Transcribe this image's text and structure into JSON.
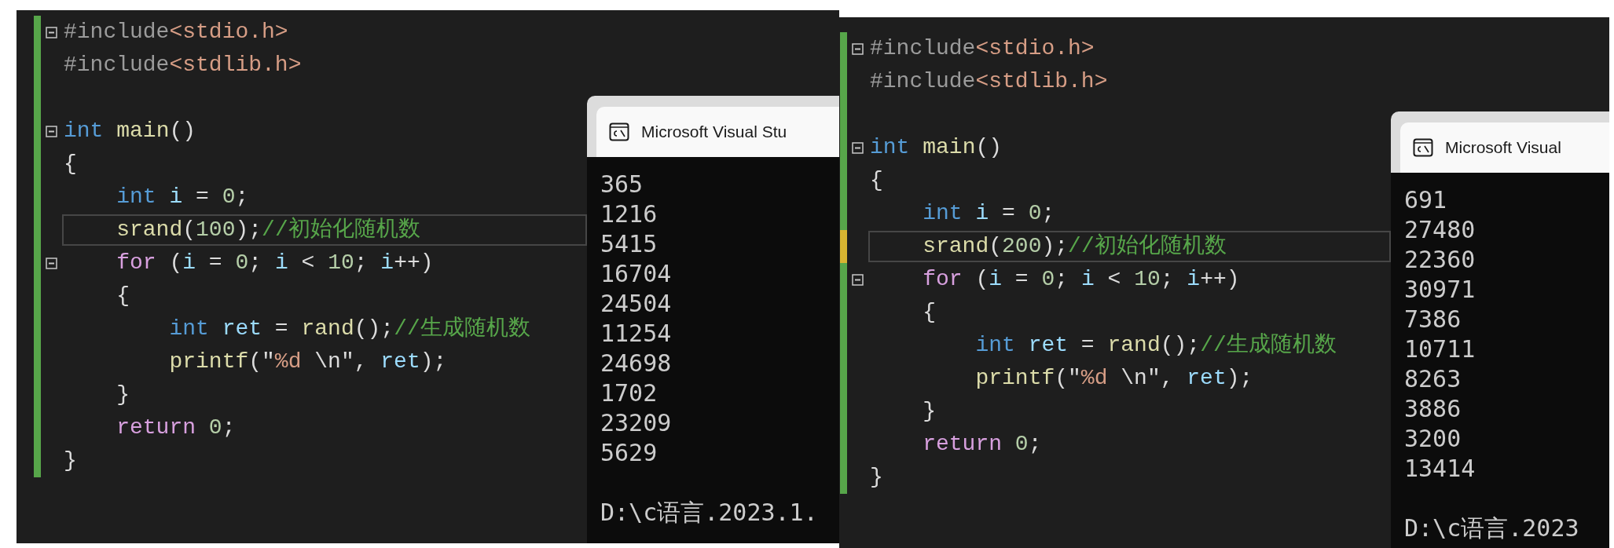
{
  "panels": [
    {
      "lines": [
        {
          "fold": true,
          "unsaved": false,
          "current": false,
          "tokens": [
            {
              "text": "#include",
              "kind": "preprocessor"
            },
            {
              "text": "<stdio.h>",
              "kind": "header"
            }
          ]
        },
        {
          "fold": false,
          "unsaved": false,
          "current": false,
          "tokens": [
            {
              "text": "#include",
              "kind": "preprocessor"
            },
            {
              "text": "<stdlib.h>",
              "kind": "header"
            }
          ]
        },
        {
          "fold": false,
          "unsaved": false,
          "current": false
        },
        {
          "fold": true,
          "unsaved": false,
          "current": false,
          "tokens": [
            {
              "text": "int ",
              "kind": "keyword"
            },
            {
              "text": "main",
              "kind": "function"
            },
            {
              "text": "()",
              "kind": "plain"
            }
          ]
        },
        {
          "fold": false,
          "unsaved": false,
          "current": false,
          "tokens": [
            {
              "text": "{",
              "kind": "plain"
            }
          ]
        },
        {
          "fold": false,
          "unsaved": false,
          "current": false,
          "tokens": [
            {
              "text": "    int ",
              "kind": "keyword"
            },
            {
              "text": "i",
              "kind": "variable"
            },
            {
              "text": " = ",
              "kind": "plain"
            },
            {
              "text": "0",
              "kind": "number"
            },
            {
              "text": ";",
              "kind": "plain"
            }
          ]
        },
        {
          "fold": false,
          "unsaved": false,
          "current": true,
          "tokens": [
            {
              "text": "    srand",
              "kind": "function"
            },
            {
              "text": "(",
              "kind": "plain"
            },
            {
              "text": "100",
              "kind": "number"
            },
            {
              "text": ");",
              "kind": "plain"
            },
            {
              "text": "//初始化随机数",
              "kind": "comment"
            }
          ]
        },
        {
          "fold": true,
          "unsaved": false,
          "current": false,
          "tokens": [
            {
              "text": "    for",
              "kind": "control"
            },
            {
              "text": " (",
              "kind": "plain"
            },
            {
              "text": "i",
              "kind": "variable"
            },
            {
              "text": " = ",
              "kind": "plain"
            },
            {
              "text": "0",
              "kind": "number"
            },
            {
              "text": "; ",
              "kind": "plain"
            },
            {
              "text": "i",
              "kind": "variable"
            },
            {
              "text": " < ",
              "kind": "plain"
            },
            {
              "text": "10",
              "kind": "number"
            },
            {
              "text": "; ",
              "kind": "plain"
            },
            {
              "text": "i",
              "kind": "variable"
            },
            {
              "text": "++)",
              "kind": "plain"
            }
          ]
        },
        {
          "fold": false,
          "unsaved": false,
          "current": false,
          "tokens": [
            {
              "text": "    {",
              "kind": "plain"
            }
          ]
        },
        {
          "fold": false,
          "unsaved": false,
          "current": false,
          "tokens": [
            {
              "text": "        int ",
              "kind": "keyword"
            },
            {
              "text": "ret",
              "kind": "variable"
            },
            {
              "text": " = ",
              "kind": "plain"
            },
            {
              "text": "rand",
              "kind": "function"
            },
            {
              "text": "();",
              "kind": "plain"
            },
            {
              "text": "//生成随机数",
              "kind": "comment"
            }
          ]
        },
        {
          "fold": false,
          "unsaved": false,
          "current": false,
          "tokens": [
            {
              "text": "        printf",
              "kind": "function"
            },
            {
              "text": "(\"",
              "kind": "plain"
            },
            {
              "text": "%d",
              "kind": "string"
            },
            {
              "text": " \\n\", ",
              "kind": "plain"
            },
            {
              "text": "ret",
              "kind": "variable"
            },
            {
              "text": ");",
              "kind": "plain"
            }
          ]
        },
        {
          "fold": false,
          "unsaved": false,
          "current": false,
          "tokens": [
            {
              "text": "    }",
              "kind": "plain"
            }
          ]
        },
        {
          "fold": false,
          "unsaved": false,
          "current": false,
          "tokens": [
            {
              "text": "    return ",
              "kind": "control"
            },
            {
              "text": "0",
              "kind": "number"
            },
            {
              "text": ";",
              "kind": "plain"
            }
          ]
        },
        {
          "fold": false,
          "unsaved": false,
          "current": false,
          "tokens": [
            {
              "text": "}",
              "kind": "plain"
            }
          ]
        }
      ],
      "console": {
        "title": "Microsoft Visual Stu",
        "output": [
          "365",
          "1216",
          "5415",
          "16704",
          "24504",
          "11254",
          "24698",
          "1702",
          "23209",
          "5629"
        ],
        "path": "D:\\c语言.2023.1."
      }
    },
    {
      "lines": [
        {
          "fold": true,
          "unsaved": false,
          "current": false,
          "tokens": [
            {
              "text": "#include",
              "kind": "preprocessor"
            },
            {
              "text": "<stdio.h>",
              "kind": "header"
            }
          ]
        },
        {
          "fold": false,
          "unsaved": false,
          "current": false,
          "tokens": [
            {
              "text": "#include",
              "kind": "preprocessor"
            },
            {
              "text": "<stdlib.h>",
              "kind": "header"
            }
          ]
        },
        {
          "fold": false,
          "unsaved": false,
          "current": false
        },
        {
          "fold": true,
          "unsaved": false,
          "current": false,
          "tokens": [
            {
              "text": "int ",
              "kind": "keyword"
            },
            {
              "text": "main",
              "kind": "function"
            },
            {
              "text": "()",
              "kind": "plain"
            }
          ]
        },
        {
          "fold": false,
          "unsaved": false,
          "current": false,
          "tokens": [
            {
              "text": "{",
              "kind": "plain"
            }
          ]
        },
        {
          "fold": false,
          "unsaved": false,
          "current": false,
          "tokens": [
            {
              "text": "    int ",
              "kind": "keyword"
            },
            {
              "text": "i",
              "kind": "variable"
            },
            {
              "text": " = ",
              "kind": "plain"
            },
            {
              "text": "0",
              "kind": "number"
            },
            {
              "text": ";",
              "kind": "plain"
            }
          ]
        },
        {
          "fold": false,
          "unsaved": true,
          "current": true,
          "tokens": [
            {
              "text": "    srand",
              "kind": "function"
            },
            {
              "text": "(",
              "kind": "plain"
            },
            {
              "text": "200",
              "kind": "number"
            },
            {
              "text": ");",
              "kind": "plain"
            },
            {
              "text": "//初始化随机数",
              "kind": "comment"
            }
          ]
        },
        {
          "fold": true,
          "unsaved": false,
          "current": false,
          "tokens": [
            {
              "text": "    for",
              "kind": "control"
            },
            {
              "text": " (",
              "kind": "plain"
            },
            {
              "text": "i",
              "kind": "variable"
            },
            {
              "text": " = ",
              "kind": "plain"
            },
            {
              "text": "0",
              "kind": "number"
            },
            {
              "text": "; ",
              "kind": "plain"
            },
            {
              "text": "i",
              "kind": "variable"
            },
            {
              "text": " < ",
              "kind": "plain"
            },
            {
              "text": "10",
              "kind": "number"
            },
            {
              "text": "; ",
              "kind": "plain"
            },
            {
              "text": "i",
              "kind": "variable"
            },
            {
              "text": "++)",
              "kind": "plain"
            }
          ]
        },
        {
          "fold": false,
          "unsaved": false,
          "current": false,
          "tokens": [
            {
              "text": "    {",
              "kind": "plain"
            }
          ]
        },
        {
          "fold": false,
          "unsaved": false,
          "current": false,
          "tokens": [
            {
              "text": "        int ",
              "kind": "keyword"
            },
            {
              "text": "ret",
              "kind": "variable"
            },
            {
              "text": " = ",
              "kind": "plain"
            },
            {
              "text": "rand",
              "kind": "function"
            },
            {
              "text": "();",
              "kind": "plain"
            },
            {
              "text": "//生成随机数",
              "kind": "comment"
            }
          ]
        },
        {
          "fold": false,
          "unsaved": false,
          "current": false,
          "tokens": [
            {
              "text": "        printf",
              "kind": "function"
            },
            {
              "text": "(\"",
              "kind": "plain"
            },
            {
              "text": "%d",
              "kind": "string"
            },
            {
              "text": " \\n\", ",
              "kind": "plain"
            },
            {
              "text": "ret",
              "kind": "variable"
            },
            {
              "text": ");",
              "kind": "plain"
            }
          ]
        },
        {
          "fold": false,
          "unsaved": false,
          "current": false,
          "tokens": [
            {
              "text": "    }",
              "kind": "plain"
            }
          ]
        },
        {
          "fold": false,
          "unsaved": false,
          "current": false,
          "tokens": [
            {
              "text": "    return ",
              "kind": "control"
            },
            {
              "text": "0",
              "kind": "number"
            },
            {
              "text": ";",
              "kind": "plain"
            }
          ]
        },
        {
          "fold": false,
          "unsaved": false,
          "current": false,
          "tokens": [
            {
              "text": "}",
              "kind": "plain"
            }
          ]
        }
      ],
      "console": {
        "title": "Microsoft Visual",
        "output": [
          "691",
          "27480",
          "22360",
          "30971",
          "7386",
          "10711",
          "8263",
          "3886",
          "3200",
          "13414"
        ],
        "path": "D:\\c语言.2023"
      }
    }
  ]
}
